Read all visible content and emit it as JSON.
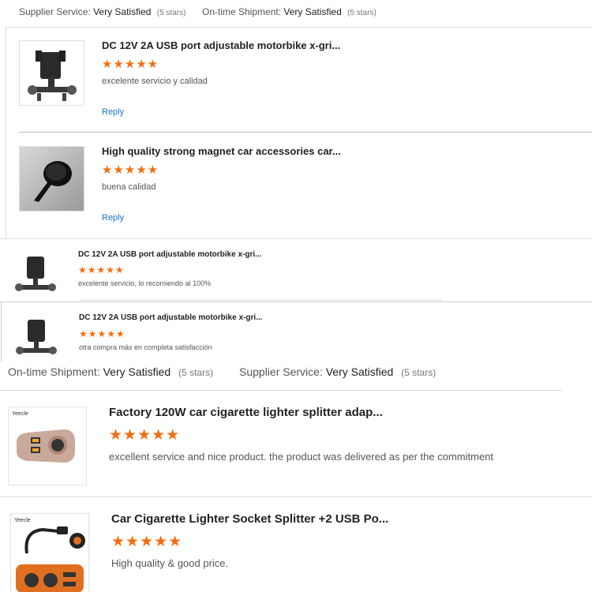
{
  "top_ratings": {
    "supplier_label": "Supplier Service:",
    "supplier_value": "Very Satisfied",
    "supplier_stars": "(5 stars)",
    "ontime_label": "On-time Shipment:",
    "ontime_value": "Very Satisfied",
    "ontime_stars": "(5 stars)"
  },
  "reviews_a": [
    {
      "title": "DC 12V 2A USB port adjustable motorbike x-gri...",
      "stars": "★★★★★",
      "text": "excelente servicio y calidad",
      "reply": "Reply",
      "image_icon": "motorbike-phone-holder-image"
    },
    {
      "title": "High quality strong magnet car accessories car...",
      "stars": "★★★★★",
      "text": "buena calidad",
      "reply": "Reply",
      "image_icon": "magnet-car-mount-image"
    }
  ],
  "reviews_b": [
    {
      "title": "DC 12V 2A USB port adjustable motorbike x-gri...",
      "stars": "★★★★★",
      "text": "excelente servicio, lo recomiendo al 100%"
    },
    {
      "title": "DC 12V 2A USB port adjustable motorbike x-gri...",
      "stars": "★★★★★",
      "text": "otra compra más en completa satisfacción"
    }
  ],
  "mid_ratings": {
    "ontime_label": "On-time Shipment:",
    "ontime_value": "Very Satisfied",
    "ontime_stars": "(5 stars)",
    "supplier_label": "Supplier Service:",
    "supplier_value": "Very Satisfied",
    "supplier_stars": "(5 stars)"
  },
  "reviews_c": [
    {
      "title": "Factory 120W car cigarette lighter splitter adap...",
      "stars": "★★★★★",
      "text": "excellent service and nice product. the product was delivered as per the commitment",
      "brand": "Yeecle"
    },
    {
      "title": "Car Cigarette Lighter Socket Splitter +2 USB Po...",
      "stars": "★★★★★",
      "text": "High quality & good price.",
      "brand": "Yeecle"
    }
  ],
  "colors": {
    "star": "#f36e10",
    "link": "#1a73c8",
    "divider": "#d9d9d9"
  }
}
